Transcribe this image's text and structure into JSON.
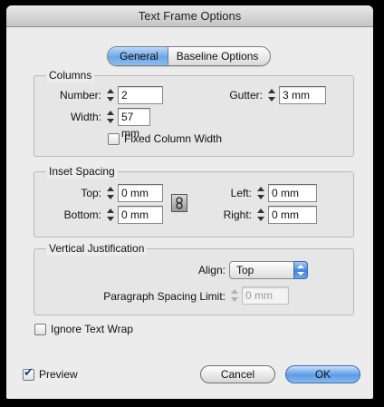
{
  "window": {
    "title": "Text Frame Options"
  },
  "tabs": [
    {
      "label": "General",
      "active": true
    },
    {
      "label": "Baseline Options",
      "active": false
    }
  ],
  "columns": {
    "title": "Columns",
    "number_label": "Number:",
    "number_value": "2",
    "gutter_label": "Gutter:",
    "gutter_value": "3 mm",
    "width_label": "Width:",
    "width_value": "57 mm",
    "fixed_width_label": "Fixed Column Width",
    "fixed_width_checked": false
  },
  "inset": {
    "title": "Inset Spacing",
    "top_label": "Top:",
    "top_value": "0 mm",
    "bottom_label": "Bottom:",
    "bottom_value": "0 mm",
    "left_label": "Left:",
    "left_value": "0 mm",
    "right_label": "Right:",
    "right_value": "0 mm",
    "link_icon": "chain-link-icon"
  },
  "vertical": {
    "title": "Vertical Justification",
    "align_label": "Align:",
    "align_value": "Top",
    "para_spacing_label": "Paragraph Spacing Limit:",
    "para_spacing_value": "0 mm"
  },
  "ignore_wrap": {
    "label": "Ignore Text Wrap",
    "checked": false
  },
  "preview": {
    "label": "Preview",
    "checked": true
  },
  "buttons": {
    "cancel": "Cancel",
    "ok": "OK"
  },
  "colors": {
    "accent": "#6ca6e5",
    "window_bg": "#ececec"
  }
}
